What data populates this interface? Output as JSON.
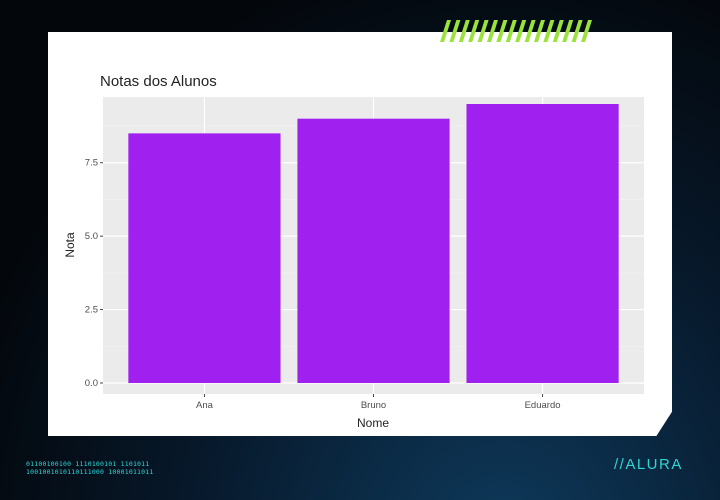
{
  "brand": {
    "name": "//ALURA",
    "binary_line1": "01100100100 1110100101  1101011",
    "binary_line2": "1001001010110111000   10001011011"
  },
  "colors": {
    "bar": "#a020f0",
    "panel": "#ebebeb",
    "grid": "#ffffff",
    "accent": "#9be33c",
    "brand": "#32d4d4"
  },
  "chart_data": {
    "type": "bar",
    "title": "Notas dos Alunos",
    "xlabel": "Nome",
    "ylabel": "Nota",
    "categories": [
      "Ana",
      "Bruno",
      "Eduardo"
    ],
    "values": [
      8.5,
      9.0,
      9.5
    ],
    "ylim": [
      0,
      9.95
    ],
    "yticks": [
      0.0,
      2.5,
      5.0,
      7.5
    ],
    "ytick_labels": [
      "0.0",
      "2.5",
      "5.0",
      "7.5"
    ],
    "grid": true,
    "legend": "none"
  }
}
